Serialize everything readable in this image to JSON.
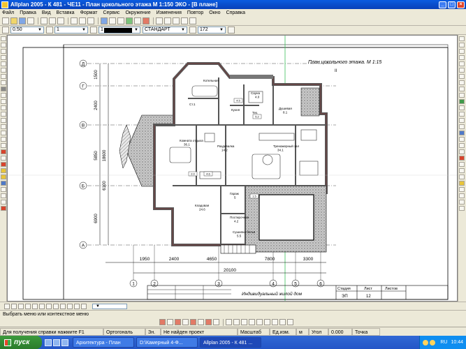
{
  "window": {
    "title": "Allplan 2005 - К 481 - ЧЕ11 - План цокольного этажа М 1:150          ЭКО - [В плане]",
    "minimize": "_",
    "maximize": "□",
    "close": "×"
  },
  "menu": [
    "Файл",
    "Правка",
    "Вид",
    "Вставка",
    "Формат",
    "Сервис",
    "Окружение",
    "Изменения",
    "Повтор",
    "Окно",
    "Справка"
  ],
  "format_bar": {
    "pen": "0.50",
    "line_type": "1",
    "color": "1",
    "layer_label": "СТАНДАРТ",
    "scale": "172"
  },
  "drawing": {
    "plan_title": "План цокольного этажа. М 1:15",
    "plan_subtitle": "II",
    "axes_letters": [
      "Д",
      "Г",
      "В",
      "Б",
      "А"
    ],
    "axes_numbers": [
      "1",
      "2",
      "3",
      "4",
      "5",
      "6"
    ],
    "dimensions_bottom": [
      "1950",
      "2400",
      "4650",
      "7800",
      "3300"
    ],
    "overall_dimension": "20100",
    "dimensions_left": [
      "1500",
      "2400",
      "5850",
      "6100",
      "18600",
      "6900"
    ],
    "rooms": [
      {
        "name": "Котельная",
        "area": ""
      },
      {
        "name": "Ст.1",
        "area": ""
      },
      {
        "name": "Кухня",
        "area": ""
      },
      {
        "name": "Сауна",
        "area": "4.0"
      },
      {
        "name": "Тех.",
        "area": "6.5"
      },
      {
        "name": "Душевая",
        "area": "8.1"
      },
      {
        "name": "Комната отдыха",
        "area": "36.1"
      },
      {
        "name": "Раздевалка",
        "area": "14.2"
      },
      {
        "name": "Тренажерный зал",
        "area": "34.1"
      },
      {
        "name": "Кладовая",
        "area": "24.6"
      },
      {
        "name": "Постирочная",
        "area": "4.2"
      },
      {
        "name": "Гараж",
        "area": "5"
      },
      {
        "name": "Сушилка белья",
        "area": "5.5"
      }
    ],
    "tags": [
      "4.5",
      "5.2",
      "2.0",
      "4.6",
      "1.5"
    ],
    "title_block": {
      "sheet_label": "Стадия",
      "sheet_col": "Лист",
      "sheets_col": "Листов",
      "stage": "ЭП",
      "sheet": "12",
      "project": "Индивидуальный жилой дом"
    }
  },
  "command_prompt": "Выбрать меню или контекстное меню",
  "status": {
    "hint": "Для получения справки нажмите F1",
    "view": "Ортогональ",
    "ref_label": "Зн.",
    "ref_value": "Не найден проект",
    "scale_label": "Масштаб",
    "units_label": "Ед.изм.",
    "units_value": "м",
    "angle_label": "Угол",
    "angle_value": "0.000",
    "extra": "Точка"
  },
  "taskbar": {
    "start": "пуск",
    "tasks": [
      "Архитектура - План",
      "D:\\Камерный 4-Ф...",
      "Allplan 2005 - К 481 ..."
    ],
    "lang": "RU",
    "clock": "10:44"
  },
  "colors": {
    "title_bar": "#0a5ce0",
    "wall": "#5a5a5a",
    "hatch": "#9a9a9a",
    "wall_outline": "#7a2a2a"
  },
  "icons": [
    "new-file-icon",
    "open-icon",
    "save-icon",
    "print-icon",
    "undo-icon",
    "redo-icon",
    "zoom-icon",
    "pen-icon",
    "line-icon",
    "circle-icon",
    "text-icon",
    "dimension-icon",
    "layer-icon"
  ]
}
